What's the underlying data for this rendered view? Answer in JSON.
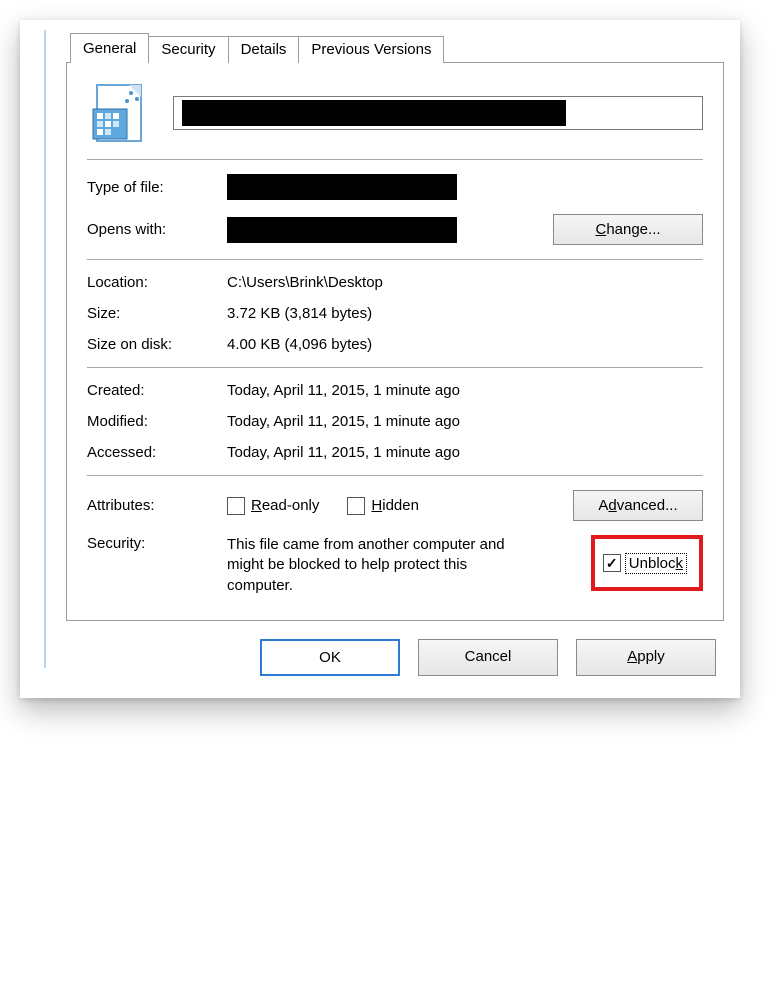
{
  "tabs": {
    "general": "General",
    "security": "Security",
    "details": "Details",
    "previous": "Previous Versions"
  },
  "labels": {
    "type_of_file": "Type of file:",
    "opens_with": "Opens with:",
    "location": "Location:",
    "size": "Size:",
    "size_on_disk": "Size on disk:",
    "created": "Created:",
    "modified": "Modified:",
    "accessed": "Accessed:",
    "attributes": "Attributes:",
    "security": "Security:"
  },
  "values": {
    "location": "C:\\Users\\Brink\\Desktop",
    "size": "3.72 KB (3,814 bytes)",
    "size_on_disk": "4.00 KB (4,096 bytes)",
    "created": "Today, April 11, 2015, 1 minute ago",
    "modified": "Today, April 11, 2015, 1 minute ago",
    "accessed": "Today, April 11, 2015, 1 minute ago",
    "security_text": "This file came from another computer and might be blocked to help protect this computer."
  },
  "buttons": {
    "change": "Change...",
    "advanced": "Advanced...",
    "ok": "OK",
    "cancel": "Cancel",
    "apply": "Apply"
  },
  "checkboxes": {
    "read_only": "Read-only",
    "hidden": "Hidden",
    "unblock": "Unblock"
  },
  "state": {
    "unblock_checked": true,
    "read_only_checked": false,
    "hidden_checked": false
  }
}
